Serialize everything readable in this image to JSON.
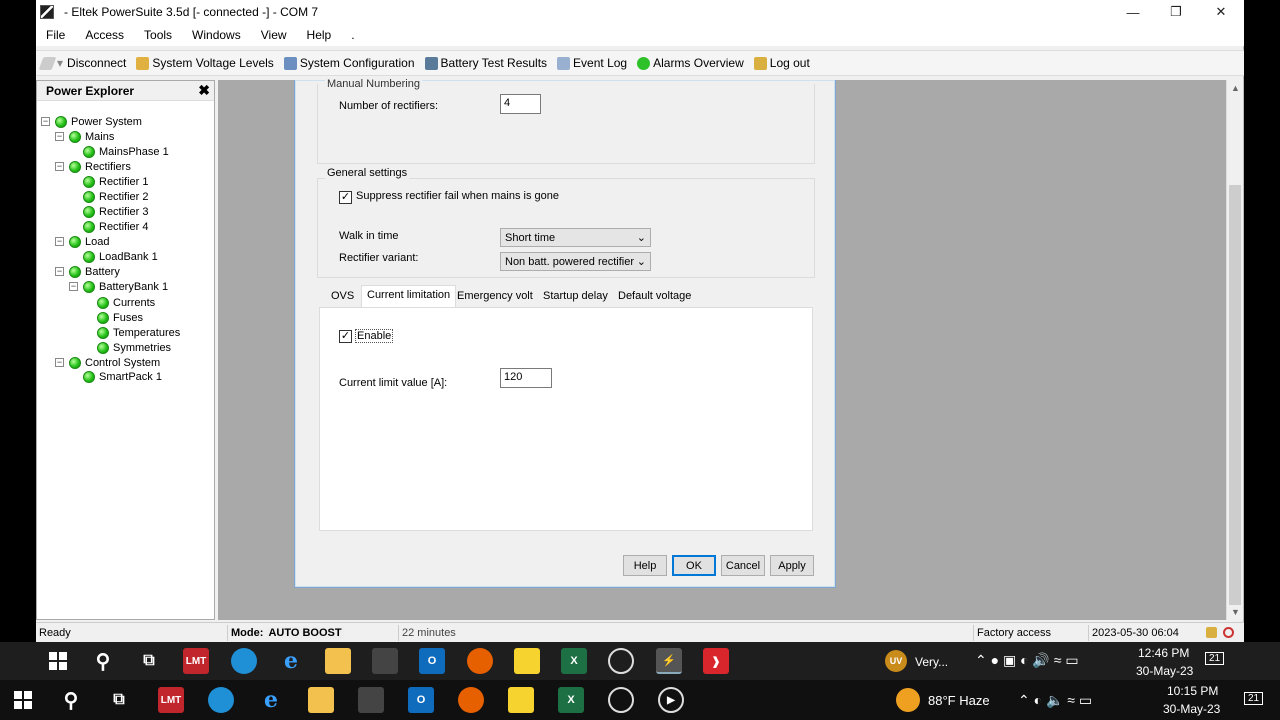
{
  "window": {
    "title": "- Eltek PowerSuite  3.5d   [- connected -] - COM 7"
  },
  "menu": [
    "File",
    "Access",
    "Tools",
    "Windows",
    "View",
    "Help",
    "."
  ],
  "toolbar": [
    {
      "label": "Disconnect",
      "icon": "pencil-icon"
    },
    {
      "label": "System Voltage Levels",
      "icon": "voltage-icon"
    },
    {
      "label": "System Configuration",
      "icon": "config-icon"
    },
    {
      "label": "Battery Test Results",
      "icon": "battery-test-icon"
    },
    {
      "label": "Event Log",
      "icon": "event-log-icon"
    },
    {
      "label": "Alarms Overview",
      "icon": "alarm-icon"
    },
    {
      "label": "Log out",
      "icon": "lock-icon"
    }
  ],
  "explorer": {
    "title": "Power Explorer",
    "tree": [
      "Power System",
      "Mains",
      "MainsPhase 1",
      "Rectifiers",
      "Rectifier 1",
      "Rectifier 2",
      "Rectifier 3",
      "Rectifier 4",
      "Load",
      "LoadBank 1",
      "Battery",
      "BatteryBank 1",
      "Currents",
      "Fuses",
      "Temperatures",
      "Symmetries",
      "Control System",
      "SmartPack 1"
    ]
  },
  "dialog": {
    "manual_numbering_label": "Manual Numbering",
    "num_rectifiers_label": "Number of rectifiers:",
    "num_rectifiers_value": "4",
    "general_settings_label": "General settings",
    "suppress_label": "Suppress rectifier fail when mains is gone",
    "suppress_checked": true,
    "walk_in_label": "Walk in time",
    "walk_in_value": "Short time",
    "variant_label": "Rectifier variant:",
    "variant_value": "Non batt. powered rectifier",
    "tabs": [
      "OVS",
      "Current limitation",
      "Emergency volt",
      "Startup delay",
      "Default voltage"
    ],
    "active_tab": "Current limitation",
    "enable_label": "Enable",
    "enable_checked": true,
    "current_limit_label": "Current limit value [A]:",
    "current_limit_value": "120",
    "buttons": {
      "help": "Help",
      "ok": "OK",
      "cancel": "Cancel",
      "apply": "Apply"
    }
  },
  "status": {
    "ready": "Ready",
    "mode_label": "Mode:",
    "mode_value": "AUTO BOOST",
    "duration": "22 minutes",
    "access": "Factory access",
    "datetime": "2023-05-30 06:04"
  },
  "taskbar_top": {
    "weather": "Very...",
    "time": "12:46 PM",
    "date": "30-May-23",
    "notifications": "21",
    "app_label": "LMT"
  },
  "taskbar_bottom": {
    "weather": "88°F  Haze",
    "time": "10:15 PM",
    "date": "30-May-23",
    "notifications": "21",
    "app_label": "LMT"
  },
  "colors": {
    "status_green": "#26c21a",
    "mdi_gray": "#a9a9a9",
    "mode_highlight": "#eeeeee"
  }
}
